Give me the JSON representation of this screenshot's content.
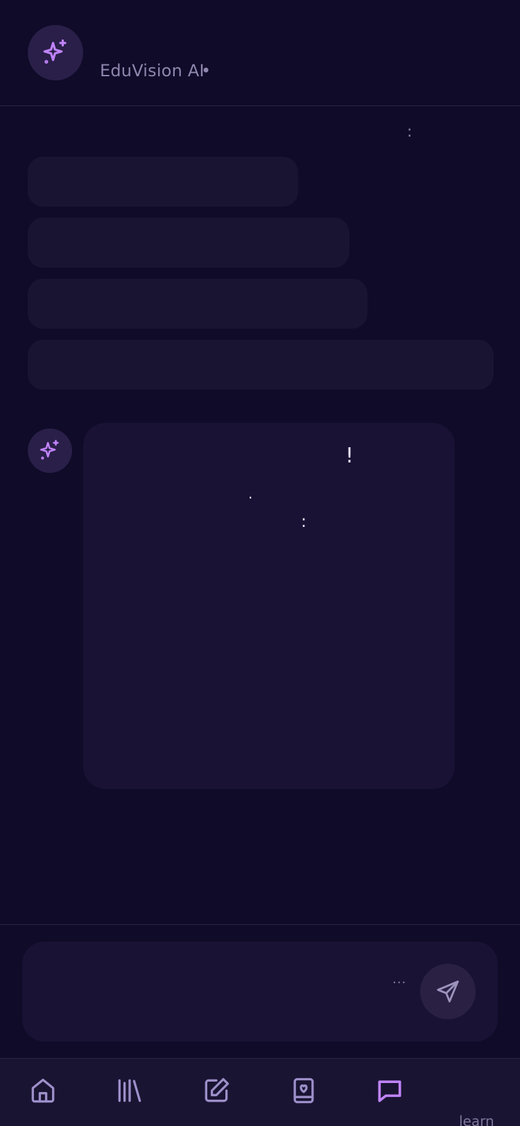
{
  "header": {
    "title": "EduVision AI",
    "status_dot": "•",
    "avatar_icon": "sparkles-icon"
  },
  "messages": {
    "stray_mark": ":",
    "ai_avatar_icon": "sparkles-icon",
    "ai_fragments": [
      "!",
      ".",
      ":"
    ]
  },
  "composer": {
    "value": "",
    "placeholder": "",
    "ellipsis": "...",
    "send_icon": "send-icon"
  },
  "bottom_nav": {
    "items": [
      {
        "icon": "home-icon"
      },
      {
        "icon": "library-icon"
      },
      {
        "icon": "edit-icon"
      },
      {
        "icon": "journal-icon"
      },
      {
        "icon": "chat-icon",
        "active": true
      }
    ],
    "learn_label": "learn"
  },
  "colors": {
    "background": "#0f0b28",
    "surface": "#1a1433",
    "accent": "#c084fc",
    "muted_text": "#8f86ad"
  }
}
